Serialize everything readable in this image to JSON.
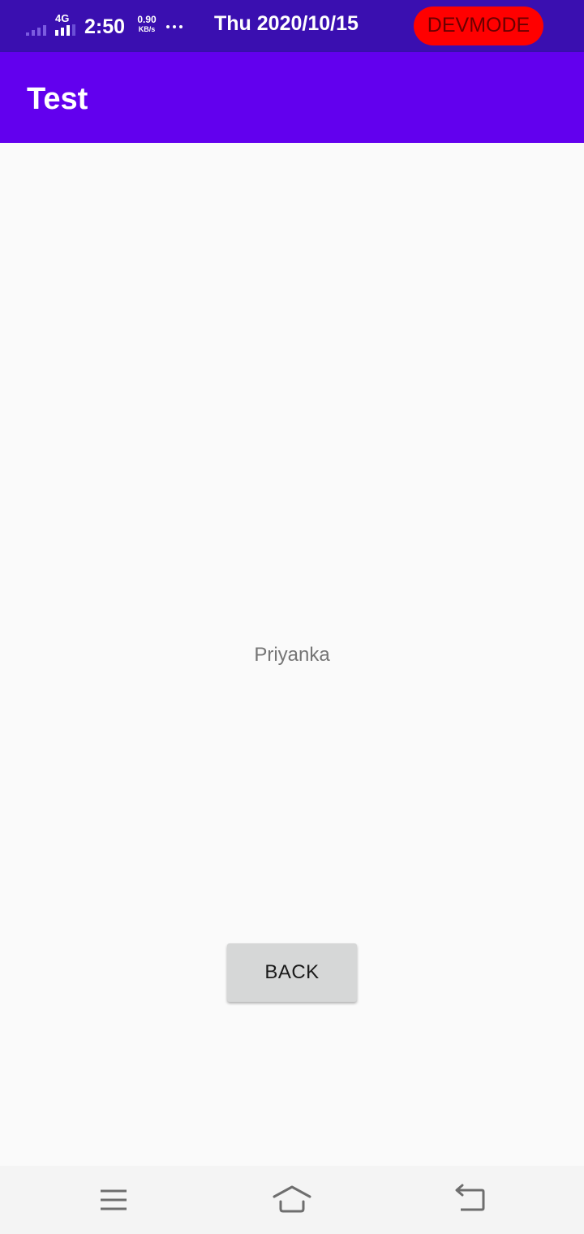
{
  "status_bar": {
    "network_type": "4G",
    "time": "2:50",
    "speed_value": "0.90",
    "speed_unit": "KB/s",
    "date": "Thu 2020/10/15",
    "devmode_label": "DEVMODE",
    "icons": [
      "signal-icon",
      "network-bars-icon",
      "more-notifications-icon"
    ]
  },
  "app_bar": {
    "title": "Test"
  },
  "content": {
    "name": "Priyanka",
    "back_label": "BACK"
  },
  "nav_bar": {
    "icons": [
      "menu-icon",
      "home-icon",
      "back-icon"
    ]
  },
  "colors": {
    "status_bar": "#3a0fb0",
    "app_bar": "#6200ee",
    "devmode_badge": "#ff0000",
    "button": "#d6d7d7",
    "background": "#fafafa"
  }
}
